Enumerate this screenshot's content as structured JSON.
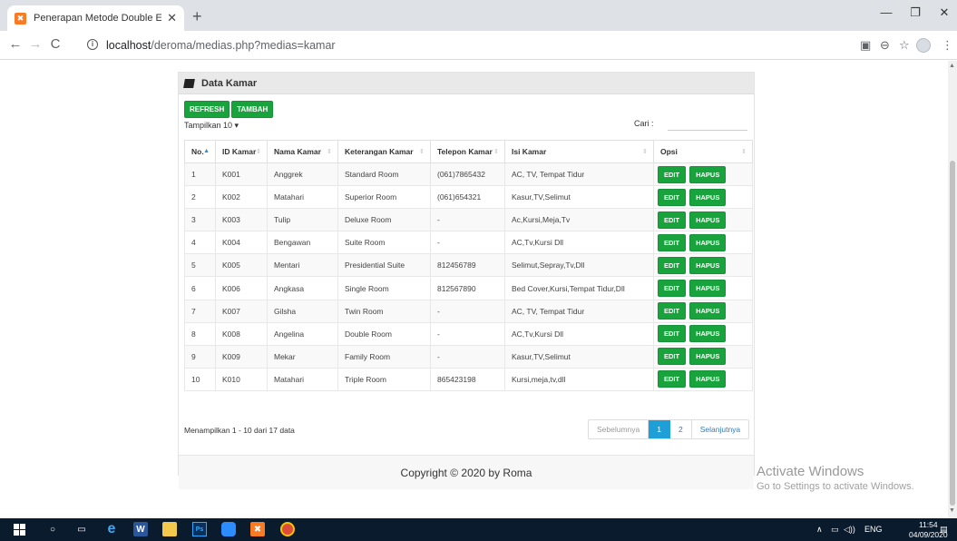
{
  "browser": {
    "tab_title": "Penerapan Metode Double Expo",
    "tab_favicon": "xampp-icon",
    "tab_favicon_text": "ඞ",
    "url_host": "localhost",
    "url_path": "/deroma/medias.php?medias=kamar"
  },
  "panel": {
    "title": "Data Kamar",
    "refresh_label": "REFRESH",
    "add_label": "TAMBAH",
    "length_label": "Tampilkan 10",
    "search_label": "Cari :",
    "search_value": "",
    "footer_text": "Copyright © 2020 by Roma"
  },
  "table": {
    "headers": [
      "No.",
      "ID Kamar",
      "Nama Kamar",
      "Keterangan Kamar",
      "Telepon Kamar",
      "Isi Kamar",
      "Opsi"
    ],
    "rows": [
      {
        "no": "1",
        "id": "K001",
        "nama": "Anggrek",
        "ket": "Standard Room",
        "telp": "(061)7865432",
        "isi": "AC, TV, Tempat Tidur"
      },
      {
        "no": "2",
        "id": "K002",
        "nama": "Matahari",
        "ket": "Superior Room",
        "telp": "(061)654321",
        "isi": "Kasur,TV,Selimut"
      },
      {
        "no": "3",
        "id": "K003",
        "nama": "Tulip",
        "ket": "Deluxe Room",
        "telp": "-",
        "isi": "Ac,Kursi,Meja,Tv"
      },
      {
        "no": "4",
        "id": "K004",
        "nama": "Bengawan",
        "ket": "Suite Room",
        "telp": "-",
        "isi": "AC,Tv,Kursi Dll"
      },
      {
        "no": "5",
        "id": "K005",
        "nama": "Mentari",
        "ket": "Presidential Suite",
        "telp": "812456789",
        "isi": "Selimut,Sepray,Tv,Dll"
      },
      {
        "no": "6",
        "id": "K006",
        "nama": "Angkasa",
        "ket": "Single Room",
        "telp": "812567890",
        "isi": "Bed Cover,Kursi,Tempat Tidur,Dll"
      },
      {
        "no": "7",
        "id": "K007",
        "nama": "Gilsha",
        "ket": "Twin Room",
        "telp": "-",
        "isi": "AC, TV, Tempat Tidur"
      },
      {
        "no": "8",
        "id": "K008",
        "nama": "Angelina",
        "ket": "Double Room",
        "telp": "-",
        "isi": "AC,Tv,Kursi Dll"
      },
      {
        "no": "9",
        "id": "K009",
        "nama": "Mekar",
        "ket": "Family Room",
        "telp": "-",
        "isi": "Kasur,TV,Selimut"
      },
      {
        "no": "10",
        "id": "K010",
        "nama": "Matahari",
        "ket": "Triple Room",
        "telp": "865423198",
        "isi": "Kursi,meja,tv,dll"
      }
    ],
    "edit_label": "EDIT",
    "delete_label": "HAPUS"
  },
  "pagination": {
    "info": "Menampilkan 1 - 10 dari 17 data",
    "prev": "Sebelumnya",
    "pages": [
      "1",
      "2"
    ],
    "active_page": "1",
    "next": "Selanjutnya"
  },
  "watermark": {
    "line1": "Activate Windows",
    "line2": "Go to Settings to activate Windows."
  },
  "taskbar": {
    "lang": "ENG",
    "time": "11:54",
    "date": "04/09/2020"
  },
  "colors": {
    "accent_green": "#18a33d",
    "pagination_active": "#1e9fd8",
    "taskbar": "#0b1b2e"
  }
}
